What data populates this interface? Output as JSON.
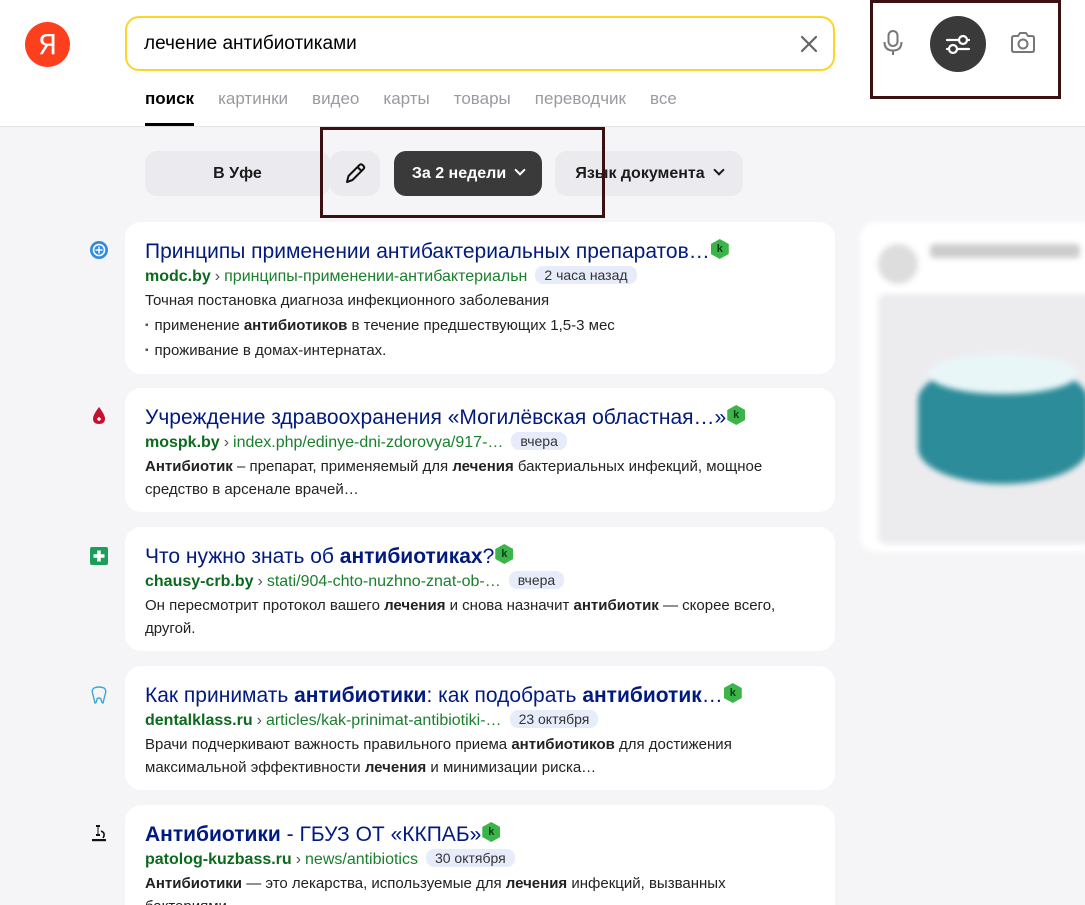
{
  "logo": {
    "letter": "Я"
  },
  "search": {
    "query": "лечение антибиотиками"
  },
  "tabs": [
    {
      "label": "поиск"
    },
    {
      "label": "картинки"
    },
    {
      "label": "видео"
    },
    {
      "label": "карты"
    },
    {
      "label": "товары"
    },
    {
      "label": "переводчик"
    },
    {
      "label": "все"
    }
  ],
  "filters": {
    "region": "В Уфе",
    "period": "За 2 недели",
    "language": "Язык документа"
  },
  "results": [
    {
      "favicon": "shield-icon",
      "title": "Принципы применении антибактериальных препаратов…",
      "domain": "modc.by",
      "path": "принципы-применении-антибактериальн",
      "date": "2 часа назад",
      "snippet_intro": "Точная постановка диагноза инфекционного заболевания",
      "bullet1_a": "применение ",
      "bullet1_b": "антибиотиков",
      "bullet1_c": " в течение предшествующих 1,5-3 мес",
      "bullet2": "проживание в домах-интернатах."
    },
    {
      "favicon": "blood-drop-icon",
      "title": "Учреждение здравоохранения «Могилёвская областная…»",
      "domain": "mospk.by",
      "path": "index.php/edinye-dni-zdorovya/917-…",
      "date": "вчера",
      "s1": "Антибиотик",
      "s2": " – препарат, применяемый для ",
      "s3": "лечения",
      "s4": " бактериальных инфекций, мощное средство в арсенале врачей…"
    },
    {
      "favicon": "medical-cross-icon",
      "title_a": "Что нужно знать об ",
      "title_b": "антибиотиках",
      "title_c": "?",
      "domain": "chausy-crb.by",
      "path": "stati/904-chto-nuzhno-znat-ob-…",
      "date": "вчера",
      "s1": "Он пересмотрит протокол вашего ",
      "s2": "лечения",
      "s3": " и снова назначит ",
      "s4": "антибиотик",
      "s5": " — скорее всего, другой."
    },
    {
      "favicon": "tooth-icon",
      "title_a": "Как принимать ",
      "title_b": "антибиотики",
      "title_c": ": как подобрать ",
      "title_d": "антибиотик",
      "title_e": "…",
      "domain": "dentalklass.ru",
      "path": "articles/kak-prinimat-antibiotiki-…",
      "date": "23 октября",
      "s1": "Врачи подчеркивают важность правильного приема ",
      "s2": "антибиотиков",
      "s3": " для достижения максимальной эффективности ",
      "s4": "лечения",
      "s5": " и минимизации риска…"
    },
    {
      "favicon": "microscope-icon",
      "title_a": "Антибиотики",
      "title_b": " - ГБУЗ ОТ «ККПАБ»",
      "domain": "patolog-kuzbass.ru",
      "path": "news/antibiotics",
      "date": "30 октября",
      "s1": "Антибиотики",
      "s2": " — это лекарства, используемые для ",
      "s3": "лечения",
      "s4": " инфекций, вызванных бактериями…"
    }
  ],
  "badge_letter": "k",
  "colors": {
    "accent": "#fed42b",
    "link": "#001a80",
    "url": "#1a7f2c",
    "logo": "#fc3f1d"
  }
}
